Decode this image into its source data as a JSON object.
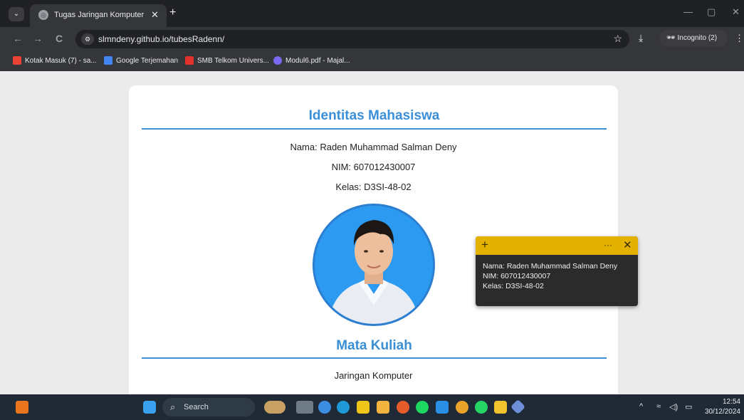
{
  "browser": {
    "tab_title": "Tugas Jaringan Komputer",
    "tab_close": "✕",
    "new_tab": "+",
    "tab_menu": "⌄",
    "window_controls": [
      "—",
      "▢",
      "✕"
    ],
    "nav": {
      "back": "←",
      "forward": "→",
      "reload": "C"
    },
    "url": "slmndeny.github.io/tubesRadenn/",
    "star": "☆",
    "download": "⤓",
    "incognito_label": "Incognito (2)",
    "menu": "⋮",
    "bookmarks": [
      {
        "label": "Kotak Masuk (7) - sa...",
        "color": "#ea4335"
      },
      {
        "label": "Google Terjemahan",
        "color": "#4285f4"
      },
      {
        "label": "SMB Telkom Univers...",
        "color": "#e0312b"
      },
      {
        "label": "Modul6.pdf - Majal...",
        "color": "#7b68ee"
      }
    ]
  },
  "page": {
    "section1_title": "Identitas Mahasiswa",
    "nama": "Nama: Raden Muhammad Salman Deny",
    "nim": "NIM: 607012430007",
    "kelas": "Kelas: D3SI-48-02",
    "section2_title": "Mata Kuliah",
    "mata_kuliah": "Jaringan Komputer",
    "accent_color": "#3a8fd6"
  },
  "sticky_note": {
    "add": "+",
    "more": "···",
    "close": "✕",
    "line1": "Nama: Raden Muhammad Salman Deny",
    "line2": "NIM: 607012430007",
    "line3": "Kelas: D3SI-48-02",
    "header_color": "#e3b200"
  },
  "taskbar": {
    "search_label": "Search",
    "time": "12:54",
    "date": "30/12/2024",
    "tray_chevron": "^"
  }
}
